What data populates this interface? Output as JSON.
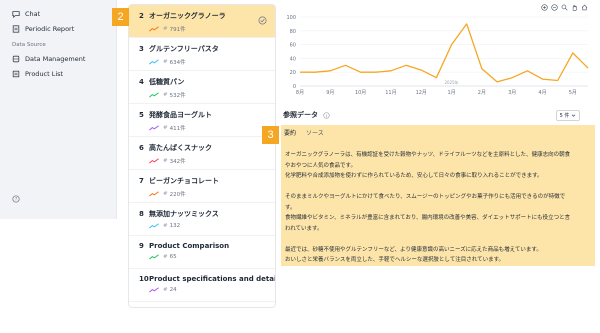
{
  "sidebar": {
    "items_top": [
      {
        "label": "Chat",
        "icon": "chat-icon"
      },
      {
        "label": "Periodic Report",
        "icon": "report-icon"
      }
    ],
    "section_label": "Data Source",
    "items_data": [
      {
        "label": "Data Management",
        "icon": "database-icon"
      },
      {
        "label": "Product List",
        "icon": "list-icon"
      }
    ]
  },
  "badges": {
    "list": "2",
    "ref": "3"
  },
  "list": [
    {
      "num": "2",
      "title": "オーガニックグラノーラ",
      "count": "791件",
      "trend": "up",
      "selected": true
    },
    {
      "num": "3",
      "title": "グルテンフリーパスタ",
      "count": "634件",
      "trend": "up"
    },
    {
      "num": "4",
      "title": "低糖質パン",
      "count": "532件",
      "trend": "up"
    },
    {
      "num": "5",
      "title": "発酵食品ヨーグルト",
      "count": "411件",
      "trend": "up"
    },
    {
      "num": "6",
      "title": "高たんぱくスナック",
      "count": "342件",
      "trend": "up"
    },
    {
      "num": "7",
      "title": "ビーガンチョコレート",
      "count": "220件",
      "trend": "up"
    },
    {
      "num": "8",
      "title": "無添加ナッツミックス",
      "count": "132",
      "trend": "up"
    },
    {
      "num": "9",
      "title": "Product Comparison",
      "count": "65",
      "trend": "up"
    },
    {
      "num": "10",
      "title": "Product specifications and details",
      "count": "24",
      "trend": "up"
    }
  ],
  "chart_data": {
    "type": "line",
    "x": [
      "8月",
      "",
      "9月",
      "",
      "10月",
      "",
      "11月",
      "",
      "12月",
      "",
      "1月",
      "",
      "2月",
      "",
      "3月",
      "",
      "4月",
      "",
      "5月",
      ""
    ],
    "x_ticks": [
      "8月",
      "9月",
      "10月",
      "11月",
      "12月",
      "1月",
      "2月",
      "3月",
      "4月",
      "5月"
    ],
    "year_label": "2025年",
    "y_ticks": [
      "0",
      "20",
      "40",
      "60",
      "80",
      "100"
    ],
    "ylim": [
      0,
      100
    ],
    "values": [
      20,
      20,
      22,
      30,
      20,
      20,
      22,
      30,
      23,
      12,
      60,
      90,
      25,
      6,
      12,
      22,
      10,
      8,
      48,
      26
    ],
    "color": "#f5a623",
    "grid": true
  },
  "reference": {
    "title": "参照データ",
    "select_label": "5 件",
    "tabs": [
      "要約",
      "ソース"
    ],
    "paragraphs": [
      "オーガニックグラノーラは、有機認証を受けた穀物やナッツ、ドライフルーツなどを主原料とした、健康志向の朝食",
      "やおやつに人気の食品です。",
      "化学肥料や合成添加物を使わずに作られているため、安心して日々の食事に取り入れることができます。",
      "",
      "そのままミルクやヨーグルトにかけて食べたり、スムージーのトッピングやお菓子作りにも活用できるのが特徴で",
      "す。",
      "食物繊維やビタミン、ミネラルが豊富に含まれており、腸内環境の改善や美容、ダイエットサポートにも役立つと言",
      "われています。",
      "",
      "最近では、砂糖不使用やグルテンフリーなど、より健康意識の高いニーズに応えた商品も増えています。",
      "おいしさと栄養バランスを両立した、手軽でヘルシーな選択肢として注目されています。"
    ]
  }
}
